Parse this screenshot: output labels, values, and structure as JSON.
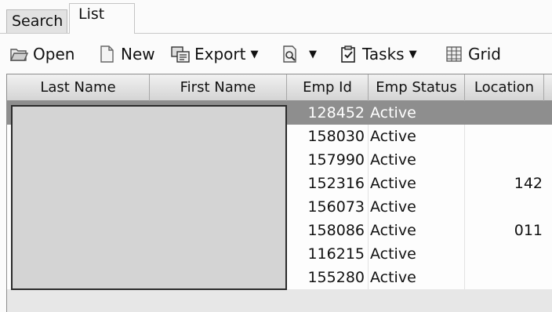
{
  "tabs": [
    {
      "label": "Search"
    },
    {
      "label": "List"
    }
  ],
  "toolbar": {
    "open_label": "Open",
    "new_label": "New",
    "export_label": "Export",
    "tasks_label": "Tasks",
    "grid_label": "Grid",
    "dropdown_arrow": "▼"
  },
  "grid": {
    "columns": [
      "Last Name",
      "First Name",
      "Emp Id",
      "Emp Status",
      "Location"
    ],
    "rows": [
      {
        "emp_id": "128452",
        "status": "Active",
        "location": ""
      },
      {
        "emp_id": "158030",
        "status": "Active",
        "location": ""
      },
      {
        "emp_id": "157990",
        "status": "Active",
        "location": ""
      },
      {
        "emp_id": "152316",
        "status": "Active",
        "location": "142"
      },
      {
        "emp_id": "156073",
        "status": "Active",
        "location": ""
      },
      {
        "emp_id": "158086",
        "status": "Active",
        "location": "011"
      },
      {
        "emp_id": "116215",
        "status": "Active",
        "location": ""
      },
      {
        "emp_id": "155280",
        "status": "Active",
        "location": ""
      }
    ],
    "selected_row": 0
  },
  "colors": {
    "selected_row": "#8e8e8e",
    "header_top": "#f1f1f1",
    "header_bottom": "#d4d4d4",
    "redaction": "#d4d4d4"
  }
}
